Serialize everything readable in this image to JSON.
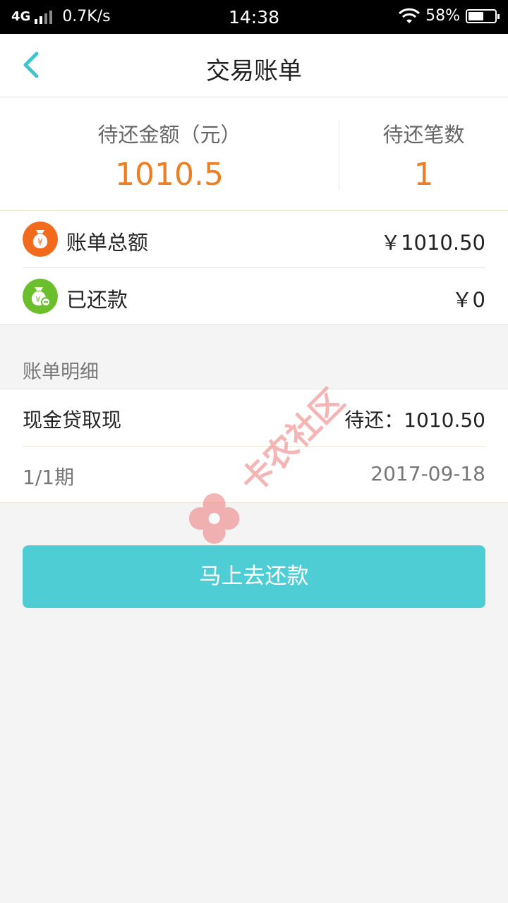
{
  "status_bar": {
    "network": "4G",
    "speed": "0.7K/s",
    "time": "14:38",
    "battery": "58%",
    "battery_level": 0.58
  },
  "nav": {
    "title": "交易账单",
    "back_icon": "chevron-left-icon"
  },
  "summary": {
    "pending_amount_label": "待还金额（元）",
    "pending_amount_value": "1010.5",
    "pending_count_label": "待还笔数",
    "pending_count_value": "1"
  },
  "amounts": [
    {
      "label": "账单总额",
      "value": "￥1010.50",
      "icon": "money-bag-icon",
      "color": "#f26b1d"
    },
    {
      "label": "已还款",
      "value": "￥0",
      "icon": "money-bag-check-icon",
      "color": "#6cbf2c"
    }
  ],
  "details": {
    "section_title": "账单明细",
    "item_name": "现金贷取现",
    "item_status": "待还：1010.50",
    "period": "1/1期",
    "date": "2017-09-18"
  },
  "repay_button": "马上去还款",
  "watermark": "卡农社区",
  "colors": {
    "accent": "#4ecdd4",
    "amount": "#ef7d22",
    "background": "#f4f4f4"
  }
}
